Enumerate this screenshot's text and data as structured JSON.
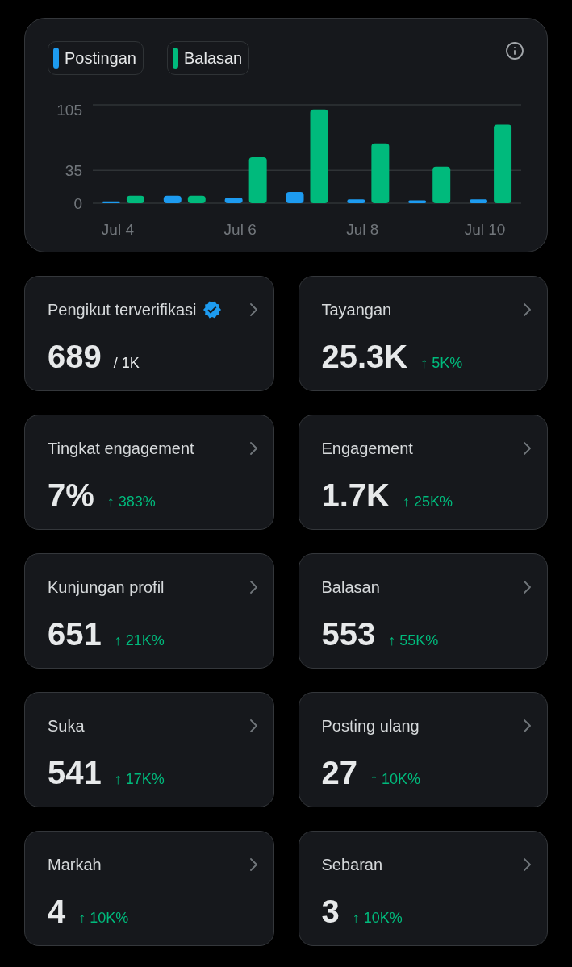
{
  "chart_panel": {
    "chart_data": {
      "type": "bar",
      "categories": [
        "Jul 4",
        null,
        "Jul 6",
        null,
        "Jul 8",
        null,
        "Jul 10"
      ],
      "series": [
        {
          "name": "Postingan",
          "color": "#1d9bf0",
          "values": [
            2,
            8,
            6,
            12,
            4,
            3,
            4
          ]
        },
        {
          "name": "Balasan",
          "color": "#00ba7c",
          "values": [
            8,
            8,
            49,
            100,
            64,
            39,
            84
          ]
        }
      ],
      "ylim": [
        0,
        105
      ],
      "yticks": [
        0,
        35,
        105
      ]
    }
  },
  "metrics": [
    {
      "title": "Pengikut terverifikasi",
      "verified": true,
      "value": "689",
      "suffix": "/ 1K"
    },
    {
      "title": "Tayangan",
      "verified": false,
      "value": "25.3K",
      "change": "↑ 5K%"
    },
    {
      "title": "Tingkat engagement",
      "verified": false,
      "value": "7%",
      "change": "↑ 383%"
    },
    {
      "title": "Engagement",
      "verified": false,
      "value": "1.7K",
      "change": "↑ 25K%"
    },
    {
      "title": "Kunjungan profil",
      "verified": false,
      "value": "651",
      "change": "↑ 21K%"
    },
    {
      "title": "Balasan",
      "verified": false,
      "value": "553",
      "change": "↑ 55K%"
    },
    {
      "title": "Suka",
      "verified": false,
      "value": "541",
      "change": "↑ 17K%"
    },
    {
      "title": "Posting ulang",
      "verified": false,
      "value": "27",
      "change": "↑ 10K%"
    },
    {
      "title": "Markah",
      "verified": false,
      "value": "4",
      "change": "↑ 10K%"
    },
    {
      "title": "Sebaran",
      "verified": false,
      "value": "3",
      "change": "↑ 10K%"
    }
  ]
}
